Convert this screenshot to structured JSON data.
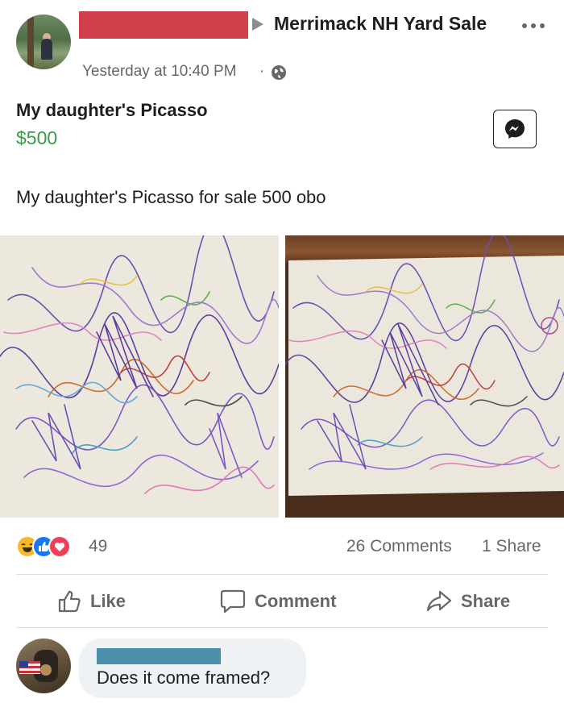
{
  "header": {
    "arrow_icon": "right-triangle-icon",
    "group_name": "Merrimack NH Yard Sale",
    "more_icon": "ellipsis-icon",
    "timestamp": "Yesterday at 10:40 PM",
    "separator": "·",
    "audience_icon": "globe-icon"
  },
  "listing": {
    "title": "My daughter's Picasso",
    "price": "$500",
    "price_color": "#3a9c46",
    "messenger_icon": "messenger-icon"
  },
  "post": {
    "text": "My daughter's Picasso for sale 500 obo"
  },
  "stats": {
    "reaction_icons": [
      "haha-icon",
      "like-icon",
      "love-icon"
    ],
    "reaction_count": "49",
    "comments": "26 Comments",
    "shares": "1 Share"
  },
  "actions": {
    "like_label": "Like",
    "comment_label": "Comment",
    "share_label": "Share"
  },
  "comment": {
    "text": "Does it come framed?"
  },
  "colors": {
    "redaction_red": "#d1404a",
    "redaction_blue": "#4a90ac",
    "facebook_blue": "#1877f2"
  }
}
